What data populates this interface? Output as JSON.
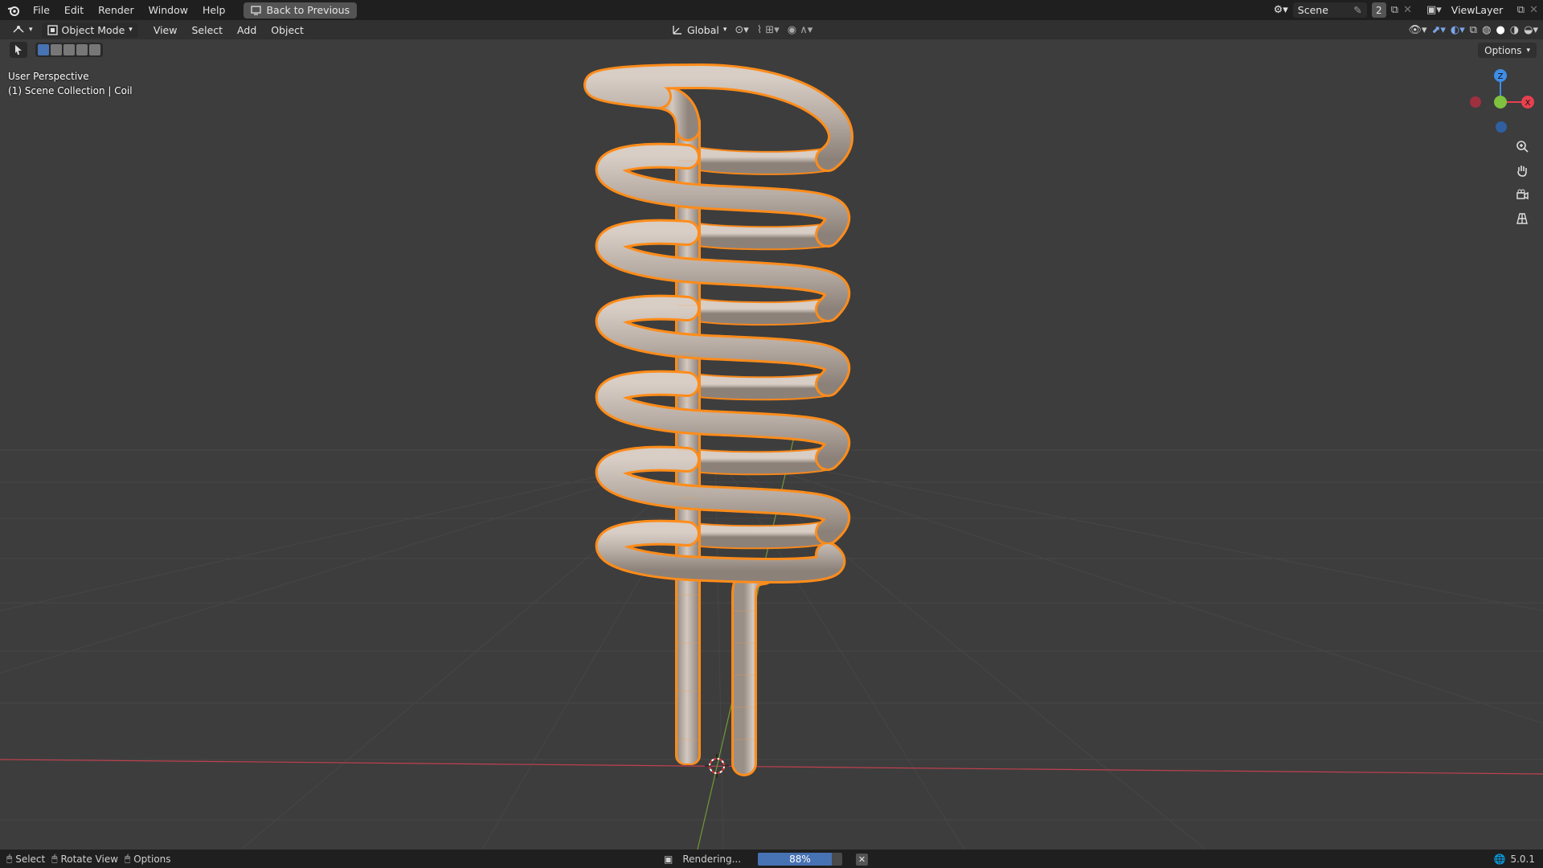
{
  "menu": {
    "file": "File",
    "edit": "Edit",
    "render": "Render",
    "window": "Window",
    "help": "Help"
  },
  "back_button": "Back to Previous",
  "scene": {
    "name": "Scene",
    "users": "2"
  },
  "view_layer": "ViewLayer",
  "header": {
    "mode": "Object Mode",
    "view": "View",
    "select": "Select",
    "add": "Add",
    "object": "Object",
    "transform_orientation": "Global"
  },
  "options_label": "Options",
  "overlay": {
    "perspective": "User Perspective",
    "collection": "(1) Scene Collection | Coil"
  },
  "status": {
    "select": "Select",
    "rotate_view": "Rotate View",
    "options": "Options",
    "rendering": "Rendering...",
    "progress_pct": "88%",
    "progress_value": 0.88,
    "version": "5.0.1"
  },
  "colors": {
    "accent": "#4772b3",
    "selection": "#ff8c1a",
    "x_axis": "#e8404f",
    "y_axis": "#7fc23f",
    "z_axis": "#3e8de8"
  }
}
